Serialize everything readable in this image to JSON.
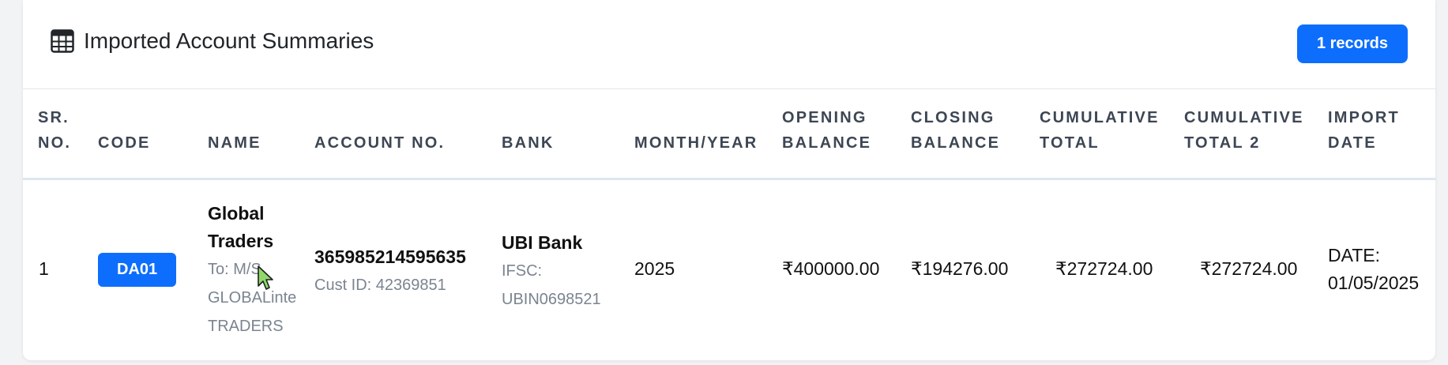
{
  "header": {
    "title": "Imported Account Summaries",
    "records_badge": "1 records",
    "icon": "table-icon"
  },
  "table": {
    "columns": [
      [
        "SR.",
        "NO."
      ],
      [
        "CODE"
      ],
      [
        "NAME"
      ],
      [
        "ACCOUNT NO."
      ],
      [
        "BANK"
      ],
      [
        "MONTH/YEAR"
      ],
      [
        "OPENING",
        "BALANCE"
      ],
      [
        "CLOSING",
        "BALANCE"
      ],
      [
        "CUMULATIVE",
        "TOTAL"
      ],
      [
        "CUMULATIVE",
        "TOTAL 2"
      ],
      [
        "IMPORT",
        "DATE"
      ]
    ],
    "rows": [
      {
        "sr_no": "1",
        "code": "DA01",
        "name_line1": "Global",
        "name_line2": "Traders",
        "to_line1": "To: M/S",
        "to_line2": "GLOBALinte",
        "to_line3": "TRADERS",
        "account_no": "365985214595635",
        "cust_id": "Cust ID: 42369851",
        "bank": "UBI Bank",
        "ifsc_label": "IFSC:",
        "ifsc_code": "UBIN0698521",
        "month_year": "2025",
        "opening_balance": "₹400000.00",
        "closing_balance": "₹194276.00",
        "cumulative_total": "₹272724.00",
        "cumulative_total_2": "₹272724.00",
        "import_date_line1": "DATE:",
        "import_date_line2": "01/05/2025"
      }
    ]
  },
  "colors": {
    "primary": "#0d6efd",
    "header_text": "#3d4654",
    "muted_text": "#7b8490"
  }
}
